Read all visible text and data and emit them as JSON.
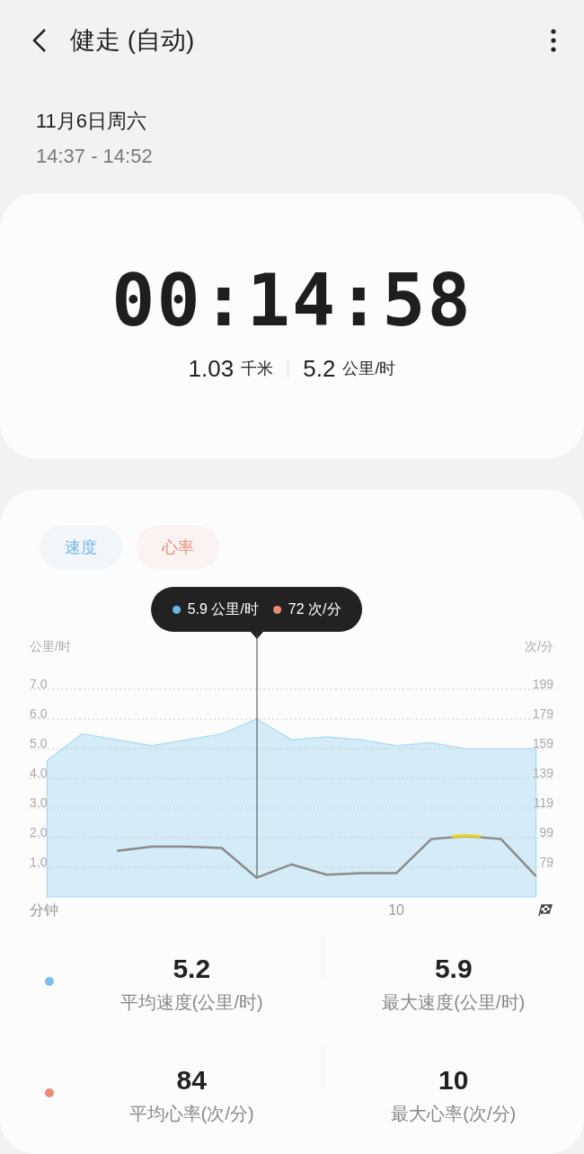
{
  "header": {
    "title": "健走 (自动)"
  },
  "session": {
    "date": "11月6日周六",
    "time_range": "14:37 - 14:52"
  },
  "summary": {
    "duration": "00:14:58",
    "distance": "1.03",
    "distance_unit": "千米",
    "speed": "5.2",
    "speed_unit": "公里/时"
  },
  "legend": [
    {
      "color": "#6fb6e8"
    },
    {
      "color": "#ef8a72"
    }
  ],
  "charts": [
    {
      "chart_data": {
        "type": "area",
        "xlabel": "分钟",
        "ylabel": "公里/时",
        "grid": true,
        "categories": [
          null,
          null,
          null,
          null,
          null,
          null,
          null,
          null,
          null,
          null,
          null,
          null,
          null,
          null,
          null
        ],
        "ylim": [
          0,
          7
        ],
        "yticks": [
          {
            "value": 1,
            "label": "1.0"
          },
          {
            "value": 2,
            "label": "2.0"
          },
          {
            "value": 3,
            "label": "3.0"
          },
          {
            "value": 4,
            "label": "4.0"
          },
          {
            "value": 5,
            "label": "5.0"
          },
          {
            "value": 6,
            "label": "6.0"
          },
          {
            "value": 7,
            "label": "7.0"
          }
        ],
        "series": [
          {
            "name": "速度",
            "color": "#a9dcf2",
            "values": [
              4.6,
              5.5,
              5.3,
              5.1,
              5.3,
              5.5,
              6.0,
              5.3,
              5.4,
              5.3,
              5.1,
              5.2,
              5.0,
              5.0,
              5.0
            ]
          }
        ],
        "annotations": [
          {
            "text": "5.9 公里/时"
          },
          {
            "text": "10"
          }
        ]
      }
    },
    {
      "chart_data": {
        "type": "line",
        "ylabel": "次/分",
        "categories": [
          null,
          null,
          null,
          null,
          null,
          null,
          null,
          null,
          null,
          null,
          null,
          null,
          null,
          null,
          null
        ],
        "ylim": [
          59,
          199
        ],
        "yticks": [
          79,
          99,
          119,
          139,
          159,
          179,
          199
        ],
        "series": [
          {
            "name": "心率",
            "color": "#8a8a8a",
            "values": [
              null,
              null,
              90,
              93,
              93,
              92,
              72,
              81,
              74,
              75,
              75,
              98,
              100,
              98,
              73
            ]
          }
        ],
        "annotations": [
          {
            "text": "72 次/分"
          }
        ]
      }
    }
  ],
  "stats": [
    {
      "color": "#7bbff0",
      "items": [
        {
          "value": "5.2",
          "label": "平均速度(公里/时)"
        },
        {
          "value": "5.9",
          "label": "最大速度(公里/时)"
        }
      ]
    },
    {
      "color": "#ef8a72",
      "items": [
        {
          "value": "84",
          "label": "平均心率(次/分)"
        },
        {
          "value": "10",
          "label": "最大心率(次/分)"
        }
      ]
    }
  ]
}
